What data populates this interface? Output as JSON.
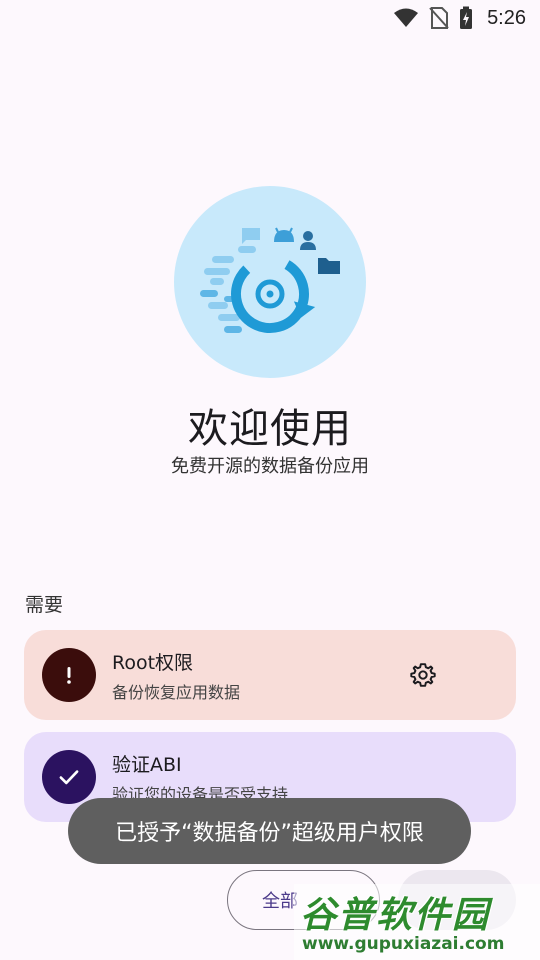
{
  "status_bar": {
    "time": "5:26",
    "icons": [
      "wifi-icon",
      "no-sim-icon",
      "battery-charging-icon"
    ]
  },
  "welcome": {
    "title": "欢迎使用",
    "subtitle": "免费开源的数据备份应用"
  },
  "requirements": {
    "label": "需要",
    "items": [
      {
        "title": "Root权限",
        "description": "备份恢复应用数据",
        "status_icon": "exclamation-icon",
        "action_icon": "gear-icon"
      },
      {
        "title": "验证ABI",
        "description": "验证您的设备是否受支持",
        "status_icon": "check-icon"
      }
    ]
  },
  "toast": {
    "message": "已授予“数据备份”超级用户权限"
  },
  "bottom": {
    "button_label": "全部"
  },
  "watermark": {
    "title": "谷普软件园",
    "url": "www.gupuxiazai.com"
  },
  "colors": {
    "background": "#fdf8fd",
    "root_card": "#f8ddd9",
    "abi_card": "#e8ddfb",
    "toast": "#5f5f5f",
    "hero_circle": "#c8e9fb",
    "hero_accent": "#1f9ad6"
  }
}
